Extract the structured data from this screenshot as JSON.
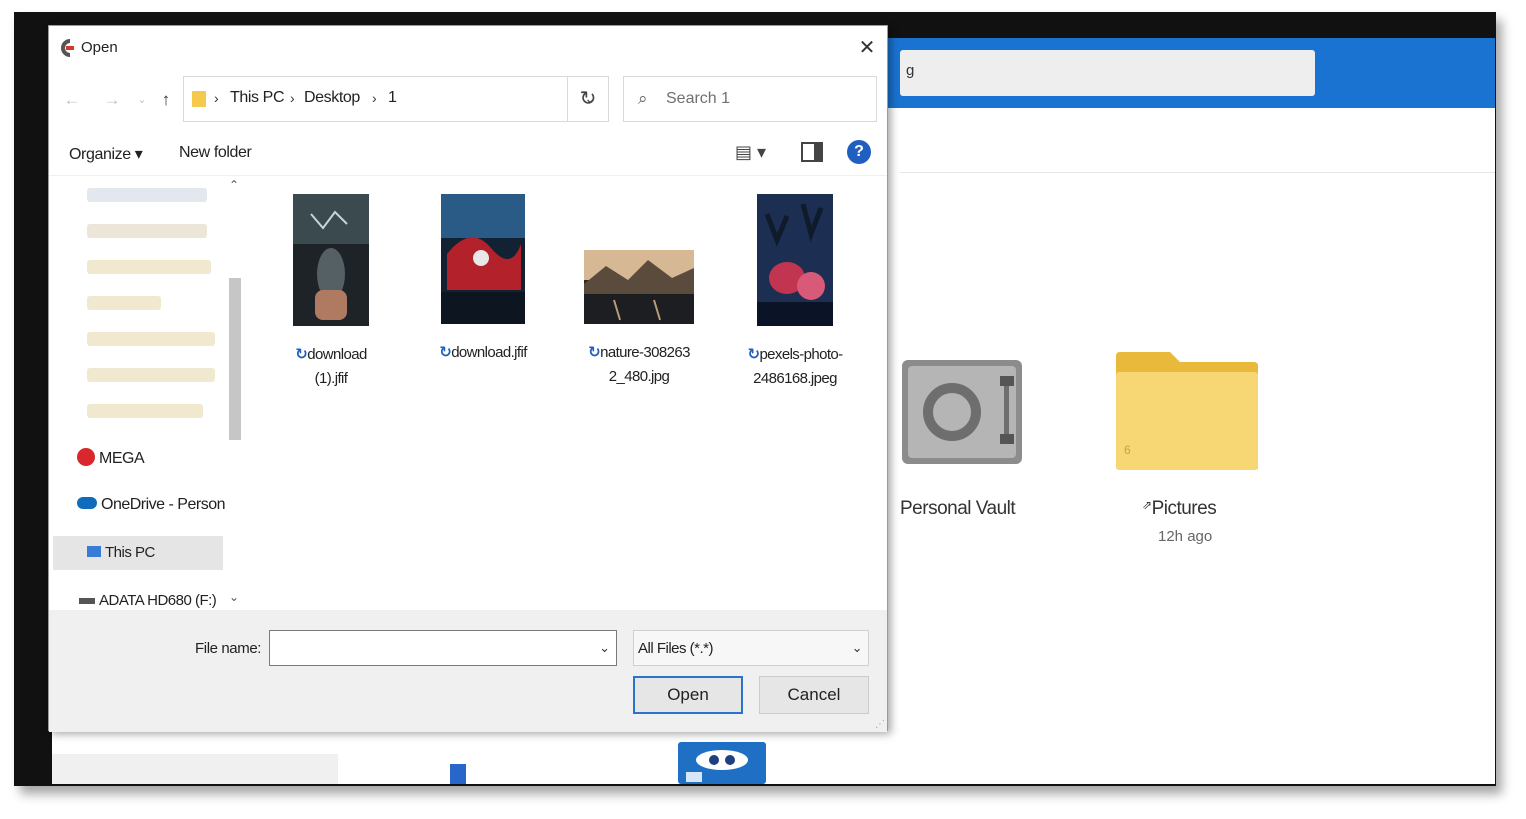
{
  "dialog": {
    "title": "Open",
    "close_label": "✕"
  },
  "nav_buttons": {
    "back": "←",
    "forward": "→",
    "recent": "⌄",
    "up": "↑"
  },
  "address_bar": {
    "crumbs": [
      "This PC",
      "Desktop",
      "1"
    ],
    "separator": "›",
    "dropdown": "⌄",
    "refresh": "↻"
  },
  "search": {
    "placeholder": "Search 1",
    "icon": "search-icon"
  },
  "toolbar": {
    "organize_label": "Organize ▾",
    "new_folder_label": "New folder",
    "view_label": "▤ ▾",
    "help_label": "?"
  },
  "nav_pane": {
    "items": [
      {
        "label": "MEGA",
        "icon": "mega-icon"
      },
      {
        "label": "OneDrive - Person",
        "icon": "onedrive-icon"
      },
      {
        "label": "This PC",
        "icon": "this-pc-icon",
        "selected": true
      },
      {
        "label": "ADATA HD680 (F:)",
        "icon": "drive-icon"
      }
    ]
  },
  "files": [
    {
      "name_line1": "download",
      "name_line2": "(1).jfif"
    },
    {
      "name_line1": "download.jfif",
      "name_line2": ""
    },
    {
      "name_line1": "nature-308263",
      "name_line2": "2_480.jpg"
    },
    {
      "name_line1": "pexels-photo-",
      "name_line2": "2486168.jpeg"
    }
  ],
  "bottom": {
    "file_name_label": "File name:",
    "file_name_value": "",
    "filter_value": "All Files (*.*)",
    "open_label": "Open",
    "cancel_label": "Cancel"
  },
  "background_app": {
    "search_text": "g",
    "vault_label": "Personal Vault",
    "pictures_label": "Pictures",
    "pictures_time": "12h ago"
  },
  "colors": {
    "accent_blue": "#1a73d1",
    "folder_yellow": "#f7d774",
    "open_button_border": "#2a74c9"
  }
}
